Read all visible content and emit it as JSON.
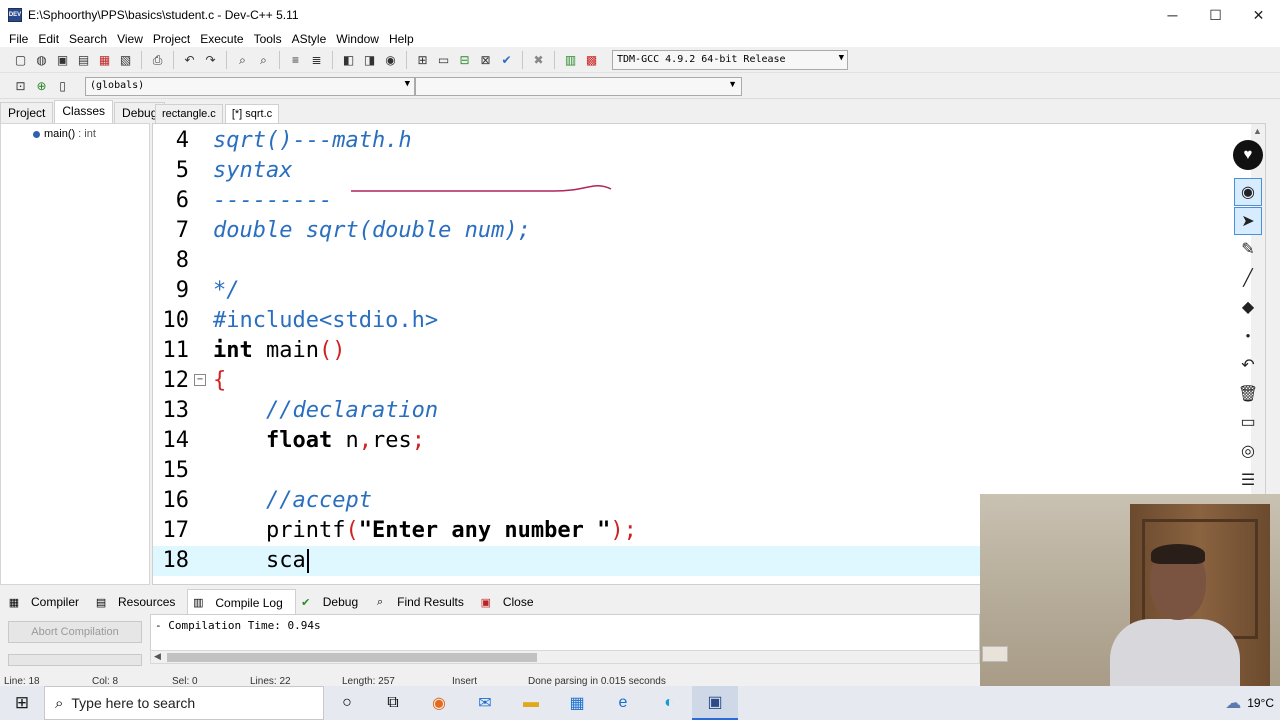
{
  "window": {
    "title": "E:\\Sphoorthy\\PPS\\basics\\student.c - Dev-C++ 5.11",
    "app_icon_text": "DEV",
    "controls": {
      "minimize": "─",
      "maximize": "☐",
      "close": "✕"
    }
  },
  "menu": [
    "File",
    "Edit",
    "Search",
    "View",
    "Project",
    "Execute",
    "Tools",
    "AStyle",
    "Window",
    "Help"
  ],
  "toolbar": {
    "compiler_select": "TDM-GCC 4.9.2 64-bit Release",
    "globals_select": "(globals)"
  },
  "left_panel": {
    "tabs": [
      "Project",
      "Classes",
      "Debug"
    ],
    "active_tab": "Classes",
    "tree_item": {
      "name": "main()",
      "signature": ": int"
    }
  },
  "editor_tabs": [
    "rectangle.c",
    "[*] sqrt.c"
  ],
  "code_lines": [
    {
      "num": "4",
      "parts": [
        {
          "c": "cmt",
          "t": "sqrt()---math.h"
        }
      ]
    },
    {
      "num": "5",
      "parts": [
        {
          "c": "cmt",
          "t": "syntax"
        }
      ]
    },
    {
      "num": "6",
      "parts": [
        {
          "c": "cmt",
          "t": "---------"
        }
      ]
    },
    {
      "num": "7",
      "parts": [
        {
          "c": "cmt",
          "t": "double sqrt(double num);"
        }
      ]
    },
    {
      "num": "8",
      "parts": []
    },
    {
      "num": "9",
      "parts": [
        {
          "c": "cmt",
          "t": "*/"
        }
      ]
    },
    {
      "num": "10",
      "parts": [
        {
          "c": "pp",
          "t": "#include<stdio.h>"
        }
      ]
    },
    {
      "num": "11",
      "parts": [
        {
          "c": "kw",
          "t": "int"
        },
        {
          "c": "plain",
          "t": " main"
        },
        {
          "c": "paren",
          "t": "()"
        }
      ]
    },
    {
      "num": "12",
      "parts": [
        {
          "c": "brace",
          "t": "{"
        }
      ],
      "fold": true
    },
    {
      "num": "13",
      "parts": [
        {
          "c": "plain",
          "t": "    "
        },
        {
          "c": "cmt",
          "t": "//declaration"
        }
      ]
    },
    {
      "num": "14",
      "parts": [
        {
          "c": "plain",
          "t": "    "
        },
        {
          "c": "kw",
          "t": "float"
        },
        {
          "c": "plain",
          "t": " n"
        },
        {
          "c": "punc",
          "t": ","
        },
        {
          "c": "plain",
          "t": "res"
        },
        {
          "c": "semi",
          "t": ";"
        }
      ]
    },
    {
      "num": "15",
      "parts": []
    },
    {
      "num": "16",
      "parts": [
        {
          "c": "plain",
          "t": "    "
        },
        {
          "c": "cmt",
          "t": "//accept"
        }
      ]
    },
    {
      "num": "17",
      "parts": [
        {
          "c": "plain",
          "t": "    printf"
        },
        {
          "c": "paren",
          "t": "("
        },
        {
          "c": "str",
          "t": "\"Enter any number \""
        },
        {
          "c": "paren",
          "t": ")"
        },
        {
          "c": "semi",
          "t": ";"
        }
      ]
    },
    {
      "num": "18",
      "parts": [
        {
          "c": "plain",
          "t": "    sca"
        }
      ],
      "current": true,
      "caret": true
    }
  ],
  "bottom_panel": {
    "tabs": [
      {
        "label": "Compiler",
        "icon": "compiler-icon"
      },
      {
        "label": "Resources",
        "icon": "resources-icon"
      },
      {
        "label": "Compile Log",
        "icon": "compile-log-icon",
        "active": true
      },
      {
        "label": "Debug",
        "icon": "debug-icon"
      },
      {
        "label": "Find Results",
        "icon": "find-results-icon"
      },
      {
        "label": "Close",
        "icon": "close-icon"
      }
    ],
    "abort_label": "Abort Compilation",
    "log_text": "- Compilation Time: 0.94s"
  },
  "status": {
    "line": "Line:    18",
    "col": "Col:    8",
    "sel": "Sel:    0",
    "lines": "Lines:    22",
    "length": "Length:    257",
    "mode": "Insert",
    "message": "Done parsing in 0.015 seconds"
  },
  "taskbar": {
    "search_placeholder": "Type here to search",
    "weather": "19°C"
  },
  "colors": {
    "comment": "#2a6fbf",
    "current_line": "#dff7ff",
    "brace": "#d02020"
  }
}
